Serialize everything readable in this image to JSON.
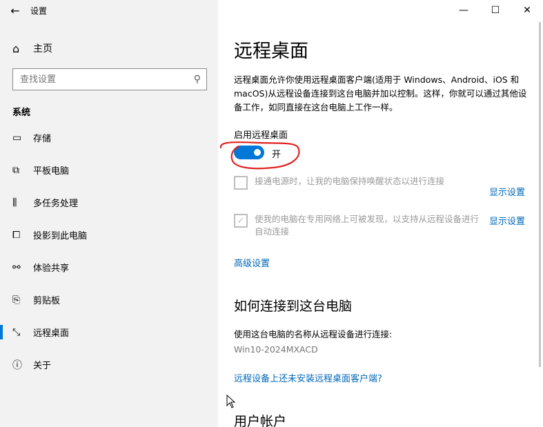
{
  "window": {
    "title": "设置",
    "back_glyph": "←",
    "minimize_glyph": "—",
    "maximize_glyph": "☐",
    "close_glyph": "✕"
  },
  "sidebar": {
    "home": {
      "label": "主页",
      "icon": "home-icon",
      "glyph": "⌂"
    },
    "search": {
      "placeholder": "查找设置",
      "icon": "search-icon",
      "glyph": "⚲"
    },
    "section": "系统",
    "items": [
      {
        "label": "存储",
        "icon": "storage-icon",
        "glyph": "▭"
      },
      {
        "label": "平板电脑",
        "icon": "tablet-icon",
        "glyph": "⧉"
      },
      {
        "label": "多任务处理",
        "icon": "multitasking-icon",
        "glyph": "⫼"
      },
      {
        "label": "投影到此电脑",
        "icon": "project-icon",
        "glyph": "⧠"
      },
      {
        "label": "体验共享",
        "icon": "shared-experiences-icon",
        "glyph": "⚯"
      },
      {
        "label": "剪贴板",
        "icon": "clipboard-icon",
        "glyph": "⎘"
      },
      {
        "label": "远程桌面",
        "icon": "remote-desktop-icon",
        "glyph": "⤡",
        "active": true
      },
      {
        "label": "关于",
        "icon": "info-icon",
        "glyph": "ⓘ"
      }
    ]
  },
  "main": {
    "title": "远程桌面",
    "description": "远程桌面允许你使用远程桌面客户端(适用于 Windows、Android、iOS 和 macOS)从远程设备连接到这台电脑并加以控制。这样，你就可以通过其他设备工作，如同直接在这台电脑上工作一样。",
    "toggle_label": "启用远程桌面",
    "toggle_state": "开",
    "toggle_on": true,
    "option1": {
      "text": "接通电源时，让我的电脑保持唤醒状态以进行连接",
      "checked": false,
      "link": "显示设置"
    },
    "option2": {
      "text": "使我的电脑在专用网络上可被发现，以支持从远程设备进行自动连接",
      "checked": true,
      "link": "显示设置"
    },
    "advanced_link": "高级设置",
    "how_to_heading": "如何连接到这台电脑",
    "use_name_text": "使用这台电脑的名称从远程设备进行连接:",
    "pc_name": "Win10-2024MXACD",
    "no_client_link": "远程设备上还未安装远程桌面客户端?",
    "user_accounts_heading": "用户帐户"
  },
  "colors": {
    "accent": "#0078d7",
    "link": "#0067b8",
    "annotation": "#e02020",
    "sidebar_bg": "#f2f2f2"
  }
}
